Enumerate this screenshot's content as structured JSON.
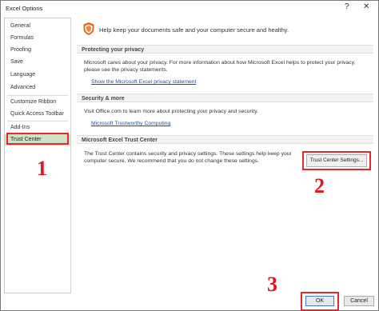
{
  "window": {
    "title": "Excel Options",
    "help_glyph": "?",
    "close_glyph": "✕"
  },
  "sidebar": {
    "items": [
      {
        "label": "General"
      },
      {
        "label": "Formulas"
      },
      {
        "label": "Proofing"
      },
      {
        "label": "Save"
      },
      {
        "label": "Language"
      },
      {
        "label": "Advanced"
      },
      {
        "label": "Customize Ribbon"
      },
      {
        "label": "Quick Access Toolbar"
      },
      {
        "label": "Add-Ins"
      },
      {
        "label": "Trust Center",
        "selected": true
      }
    ]
  },
  "main": {
    "headline": "Help keep your documents safe and your computer secure and healthy.",
    "sections": [
      {
        "title": "Protecting your privacy",
        "text_line1": "Microsoft cares about your privacy. For more information about how Microsoft Excel helps to protect your privacy,",
        "text_line2": "please see the privacy statements.",
        "link": "Show the Microsoft Excel privacy statement"
      },
      {
        "title": "Security & more",
        "text_line1": "Visit Office.com to learn more about protecting your privacy and security.",
        "link": "Microsoft Trustworthy Computing"
      },
      {
        "title": "Microsoft Excel Trust Center",
        "text_line1": "The Trust Center contains security and privacy settings. These settings help keep your",
        "text_line2": "computer secure. We recommend that you do not change these settings.",
        "button": "Trust Center Settings..."
      }
    ]
  },
  "footer": {
    "ok_label": "OK",
    "cancel_label": "Cancel"
  },
  "annotations": {
    "step1": "1",
    "step2": "2",
    "step3": "3"
  },
  "colors": {
    "accent_red": "#e8262e",
    "selected_bg": "#cfe3c4",
    "link": "#1f4e9c",
    "shield": "#e8641b"
  }
}
